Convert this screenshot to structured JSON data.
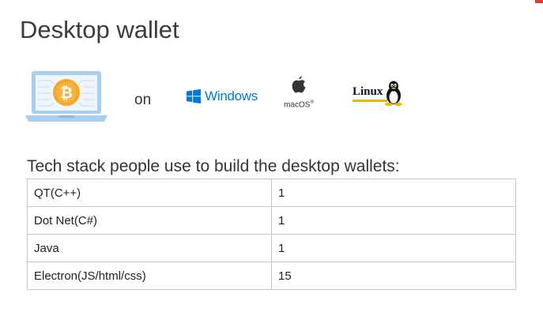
{
  "page": {
    "title": "Desktop wallet",
    "on_label": "on"
  },
  "platforms": {
    "windows_label": "Windows",
    "macos_label": "macOS",
    "macos_mark": "®",
    "linux_label": "Linux"
  },
  "tech_stack": {
    "heading": "Tech stack people use to build the desktop wallets:",
    "rows": [
      {
        "name": "QT(C++)",
        "count": "1"
      },
      {
        "name": "Dot Net(C#)",
        "count": "1"
      },
      {
        "name": "Java",
        "count": "1"
      },
      {
        "name": "Electron(JS/html/css)",
        "count": "15"
      }
    ]
  },
  "colors": {
    "bitcoin_orange": "#f7a823",
    "windows_blue": "#0078d7",
    "laptop_blue": "#a9cff0",
    "accent_red": "#e03b30"
  }
}
